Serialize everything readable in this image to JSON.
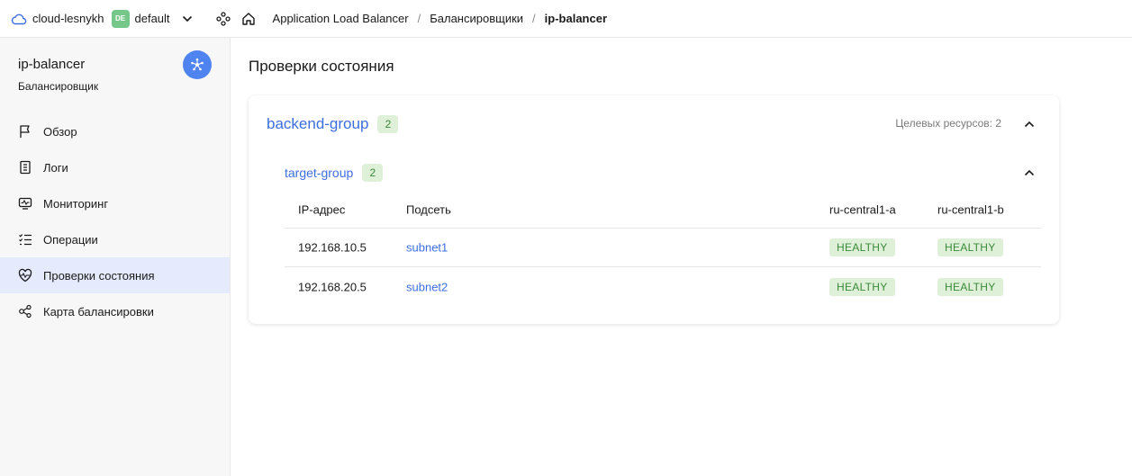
{
  "topbar": {
    "cloud_name": "cloud-lesnykh",
    "folder_badge": "DE",
    "folder_name": "default",
    "breadcrumbs": [
      "Application Load Balancer",
      "Балансировщики",
      "ip-balancer"
    ]
  },
  "sidebar": {
    "title": "ip-balancer",
    "subtitle": "Балансировщик",
    "items": [
      {
        "label": "Обзор",
        "icon": "flag-icon"
      },
      {
        "label": "Логи",
        "icon": "logs-icon"
      },
      {
        "label": "Мониторинг",
        "icon": "monitoring-icon"
      },
      {
        "label": "Операции",
        "icon": "operations-icon"
      },
      {
        "label": "Проверки состояния",
        "icon": "heartbeat-icon",
        "active": true
      },
      {
        "label": "Карта балансировки",
        "icon": "map-icon"
      }
    ]
  },
  "main": {
    "page_title": "Проверки состояния",
    "backend_group": {
      "name": "backend-group",
      "count": "2",
      "targets_label": "Целевых ресурсов: 2"
    },
    "target_group": {
      "name": "target-group",
      "count": "2"
    },
    "table": {
      "headers": [
        "IP-адрес",
        "Подсеть",
        "ru-central1-a",
        "ru-central1-b"
      ],
      "rows": [
        {
          "ip": "192.168.10.5",
          "subnet": "subnet1",
          "zone_a": "HEALTHY",
          "zone_b": "HEALTHY"
        },
        {
          "ip": "192.168.20.5",
          "subnet": "subnet2",
          "zone_a": "HEALTHY",
          "zone_b": "HEALTHY"
        }
      ]
    }
  },
  "colors": {
    "accent": "#3d6ee0",
    "healthy_bg": "#dff0d8",
    "healthy_text": "#3a8a3a",
    "active_nav_bg": "#e5ebfd",
    "logo_bg": "#4f83f0"
  }
}
